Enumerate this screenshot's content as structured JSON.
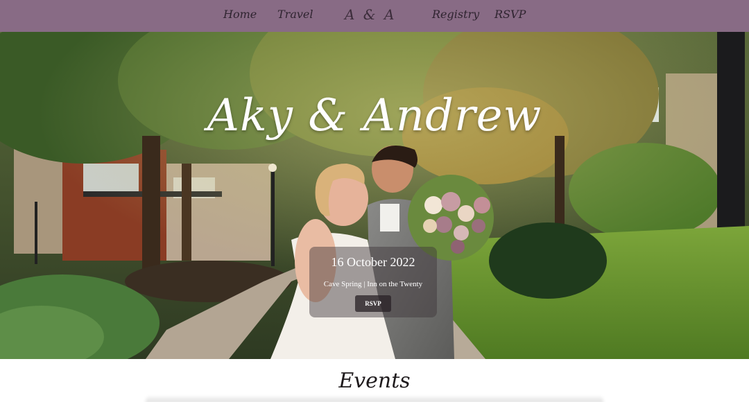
{
  "nav": {
    "links": [
      {
        "label": "Home"
      },
      {
        "label": "Travel"
      },
      {
        "label": "Registry"
      },
      {
        "label": "RSVP"
      }
    ],
    "logo": "A & A"
  },
  "hero": {
    "title": "Aky & Andrew",
    "date": "16 October 2022",
    "location": "Cave Spring | Inn on the Twenty",
    "rsvp_button": "RSVP"
  },
  "events": {
    "heading": "Events"
  },
  "colors": {
    "nav_background": "#886b85",
    "nav_text": "#2f2430",
    "hero_text": "#ffffff"
  }
}
